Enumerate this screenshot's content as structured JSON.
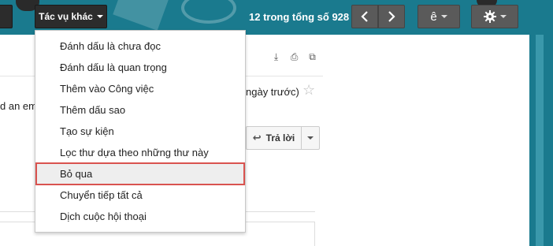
{
  "toolbar": {
    "more_actions_label": "Tác vụ khác",
    "pager_text": "12 trong tổng số 928",
    "prev_icon": "chevron-left-icon",
    "next_icon": "chevron-right-icon",
    "language_label": "ê",
    "settings_icon": "gear-icon"
  },
  "menu": {
    "items": [
      {
        "label": "Đánh dấu là chưa đọc"
      },
      {
        "label": "Đánh dấu là quan trọng"
      },
      {
        "label": "Thêm vào Công việc"
      },
      {
        "label": "Thêm dấu sao"
      },
      {
        "label": "Tạo sự kiện"
      },
      {
        "label": "Lọc thư dựa theo những thư này"
      },
      {
        "label": "Bỏ qua",
        "highlighted": true
      },
      {
        "label": "Chuyển tiếp tất cả"
      },
      {
        "label": "Dịch cuộc hội thoại"
      }
    ]
  },
  "message": {
    "partial_sender_text": "d an em",
    "partial_date_text": "ngày trước)",
    "reply_label": "Trả lời"
  },
  "colors": {
    "topbar": "#1a7a8e",
    "highlight_border": "#d9534f"
  }
}
